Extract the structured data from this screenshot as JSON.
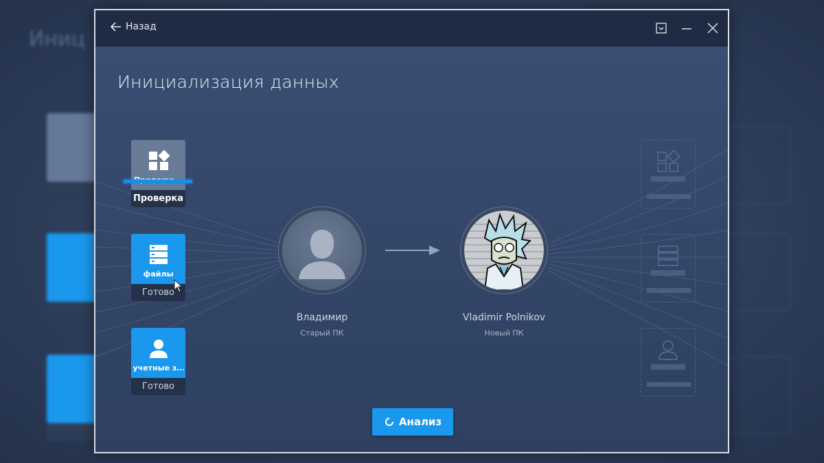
{
  "background": {
    "title": "Иниц"
  },
  "titlebar": {
    "back_label": "Назад",
    "icons": [
      "arrow-left-icon",
      "dropdown-icon",
      "minimize-icon",
      "close-icon"
    ]
  },
  "page": {
    "title": "Инициализация данных"
  },
  "tasks": [
    {
      "name": "Приложе...",
      "status": "Проверка",
      "icon": "apps-icon",
      "color": "#6a7b98",
      "in_progress": true
    },
    {
      "name": "файлы",
      "status": "Готово",
      "icon": "files-icon",
      "color": "#1a98ee",
      "in_progress": false
    },
    {
      "name": "учетные з...",
      "status": "Готово",
      "icon": "account-icon",
      "color": "#1a98ee",
      "in_progress": false
    }
  ],
  "source": {
    "name": "Владимир",
    "label": "Старый ПК"
  },
  "target": {
    "name": "Vladimir Polnikov",
    "label": "Новый ПК"
  },
  "actions": {
    "analyze_label": "Анализ"
  },
  "colors": {
    "accent": "#1a98ee",
    "titlebar": "#1f2b43",
    "window": "#34476a"
  }
}
